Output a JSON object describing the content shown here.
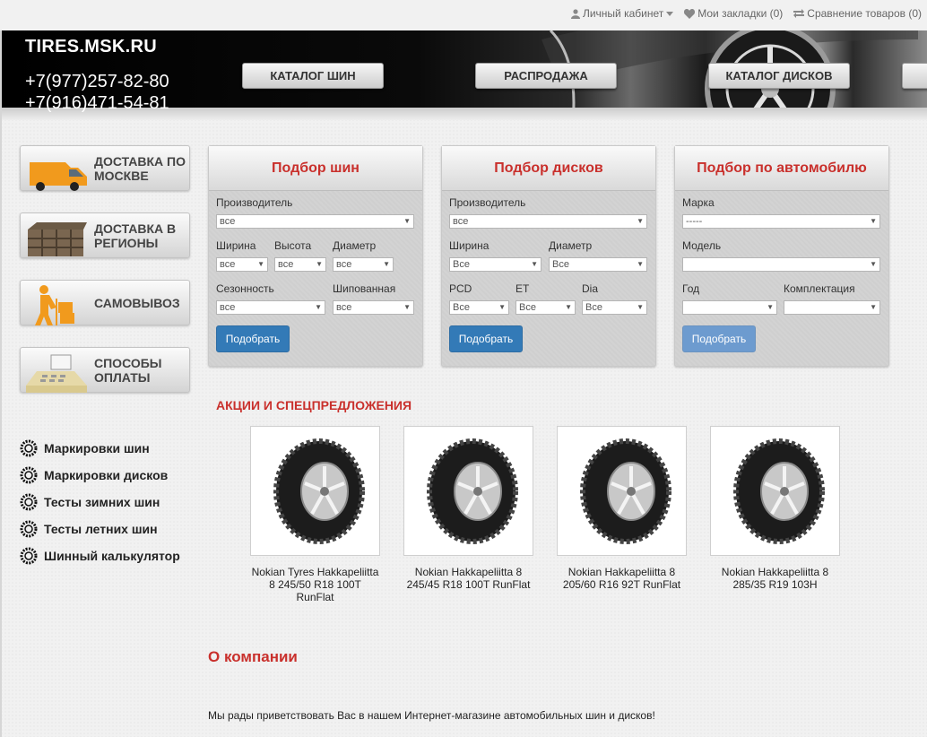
{
  "topbar": {
    "account": "Личный кабинет",
    "bookmarks": "Мои закладки (0)",
    "compare": "Сравнение товаров (0)"
  },
  "header": {
    "logo": "TIRES.MSK.RU",
    "phone1": "+7(977)257-82-80",
    "phone2": "+7(916)471-54-81",
    "nav": [
      "КАТАЛОГ ШИН",
      "РАСПРОДАЖА",
      "КАТАЛОГ ДИСКОВ"
    ]
  },
  "services": [
    {
      "label": "ДОСТАВКА ПО МОСКВЕ",
      "icon": "delivery-van-icon"
    },
    {
      "label": "ДОСТАВКА В РЕГИОНЫ",
      "icon": "cargo-box-icon"
    },
    {
      "label": "САМОВЫВОЗ",
      "icon": "pickup-person-icon"
    },
    {
      "label": "СПОСОБЫ ОПЛАТЫ",
      "icon": "cash-register-icon"
    }
  ],
  "side_links": [
    "Маркировки шин",
    "Маркировки дисков",
    "Тесты зимних шин",
    "Тесты летних шин",
    "Шинный калькулятор"
  ],
  "tire_panel": {
    "title": "Подбор шин",
    "manufacturer_label": "Производитель",
    "manufacturer_value": "все",
    "width_label": "Ширина",
    "width_value": "все",
    "height_label": "Высота",
    "height_value": "все",
    "diameter_label": "Диаметр",
    "diameter_value": "все",
    "season_label": "Сезонность",
    "season_value": "все",
    "studded_label": "Шипованная",
    "studded_value": "все",
    "button": "Подобрать"
  },
  "disk_panel": {
    "title": "Подбор дисков",
    "manufacturer_label": "Производитель",
    "manufacturer_value": "все",
    "width_label": "Ширина",
    "width_value": "Все",
    "diameter_label": "Диаметр",
    "diameter_value": "Все",
    "pcd_label": "PCD",
    "pcd_value": "Все",
    "et_label": "ET",
    "et_value": "Все",
    "dia_label": "Dia",
    "dia_value": "Все",
    "button": "Подобрать"
  },
  "car_panel": {
    "title": "Подбор по автомобилю",
    "brand_label": "Марка",
    "brand_value": "-----",
    "model_label": "Модель",
    "model_value": "",
    "year_label": "Год",
    "year_value": "",
    "trim_label": "Комплектация",
    "trim_value": "",
    "button": "Подобрать"
  },
  "promo": {
    "title": "АКЦИИ И СПЕЦПРЕДЛОЖЕНИЯ",
    "products": [
      {
        "name": "Nokian Tyres Hakkapeliitta 8 245/50 R18 100T RunFlat"
      },
      {
        "name": "Nokian Hakkapeliitta 8 245/45 R18 100T RunFlat"
      },
      {
        "name": "Nokian Hakkapeliitta 8 205/60 R16 92T RunFlat"
      },
      {
        "name": "Nokian Hakkapeliitta 8 285/35 R19 103H"
      }
    ]
  },
  "about": {
    "title": "О компании",
    "text": "Мы рады приветствовать Вас в нашем Интернет-магазине автомобильных шин и дисков!"
  },
  "colors": {
    "accent": "#c9302c",
    "button": "#337ab7"
  }
}
